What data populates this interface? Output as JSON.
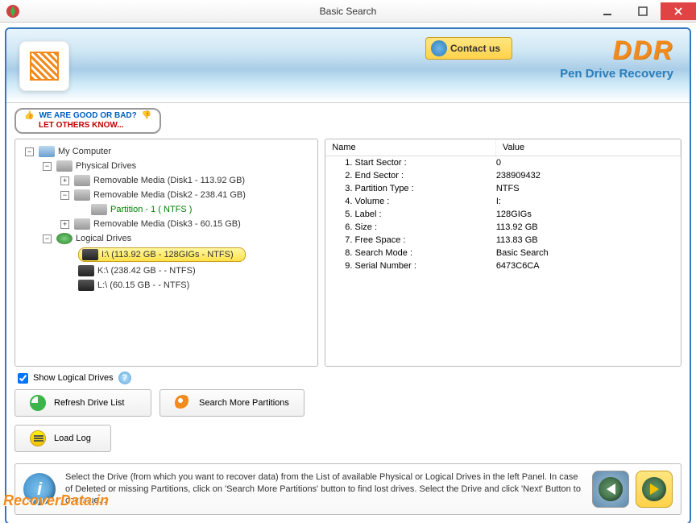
{
  "window": {
    "title": "Basic Search"
  },
  "banner": {
    "contact": "Contact us",
    "brand": "DDR",
    "subtitle": "Pen Drive Recovery"
  },
  "review": {
    "line1": "WE ARE GOOD OR BAD?",
    "line2": "LET OTHERS KNOW..."
  },
  "tree": {
    "root": "My Computer",
    "physical": "Physical Drives",
    "disk1": "Removable Media (Disk1 - 113.92 GB)",
    "disk2": "Removable Media (Disk2 - 238.41 GB)",
    "partition1": "Partition - 1 ( NTFS )",
    "disk3": "Removable Media (Disk3 - 60.15 GB)",
    "logical": "Logical Drives",
    "driveI": "I:\\ (113.92 GB - 128GIGs - NTFS)",
    "driveK": "K:\\ (238.42 GB -  - NTFS)",
    "driveL": "L:\\ (60.15 GB -  - NTFS)"
  },
  "props": {
    "headerName": "Name",
    "headerValue": "Value",
    "rows": [
      {
        "name": "1. Start Sector :",
        "value": "0"
      },
      {
        "name": "2. End Sector :",
        "value": "238909432"
      },
      {
        "name": "3. Partition Type :",
        "value": "NTFS"
      },
      {
        "name": "4. Volume :",
        "value": "I:"
      },
      {
        "name": "5. Label :",
        "value": "128GIGs"
      },
      {
        "name": "6. Size :",
        "value": "113.92 GB"
      },
      {
        "name": "7. Free Space :",
        "value": "113.83 GB"
      },
      {
        "name": "8. Search Mode :",
        "value": "Basic Search"
      },
      {
        "name": "9. Serial Number :",
        "value": "6473C6CA"
      }
    ]
  },
  "options": {
    "showLogical": "Show Logical Drives"
  },
  "buttons": {
    "refresh": "Refresh Drive List",
    "searchMore": "Search More Partitions",
    "loadLog": "Load Log"
  },
  "footer": {
    "text": "Select the Drive (from which you want to recover data) from the List of available Physical or Logical Drives in the left Panel. In case of Deleted or missing Partitions, click on 'Search More Partitions' button to find lost drives. Select the Drive and click 'Next' Button to continue..."
  },
  "watermark": "RecoverData.in"
}
